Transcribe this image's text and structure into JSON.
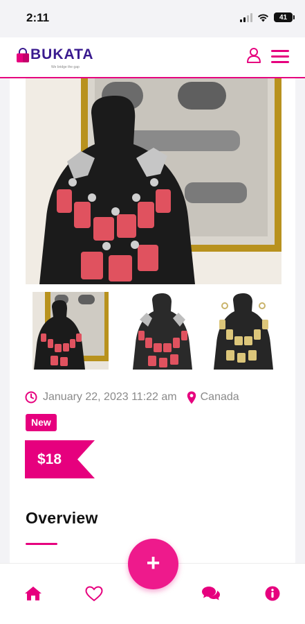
{
  "status_bar": {
    "time": "2:11",
    "battery": "41"
  },
  "header": {
    "logo_text": "BUKATA",
    "tagline": "We bridge the gap"
  },
  "listing": {
    "posted": "January 22, 2023 11:22 am",
    "location": "Canada",
    "condition": "New",
    "price": "$18"
  },
  "gallery": {
    "thumbnail_count": 3,
    "selected_thumbnail": 1
  },
  "overview": {
    "title": "Overview"
  },
  "colors": {
    "accent": "#e6007e",
    "brand_dark": "#3a1b8f"
  },
  "bottom_nav": {
    "items": [
      "home-icon",
      "heart-icon",
      "chat-icon",
      "info-icon"
    ],
    "fab": "+"
  }
}
